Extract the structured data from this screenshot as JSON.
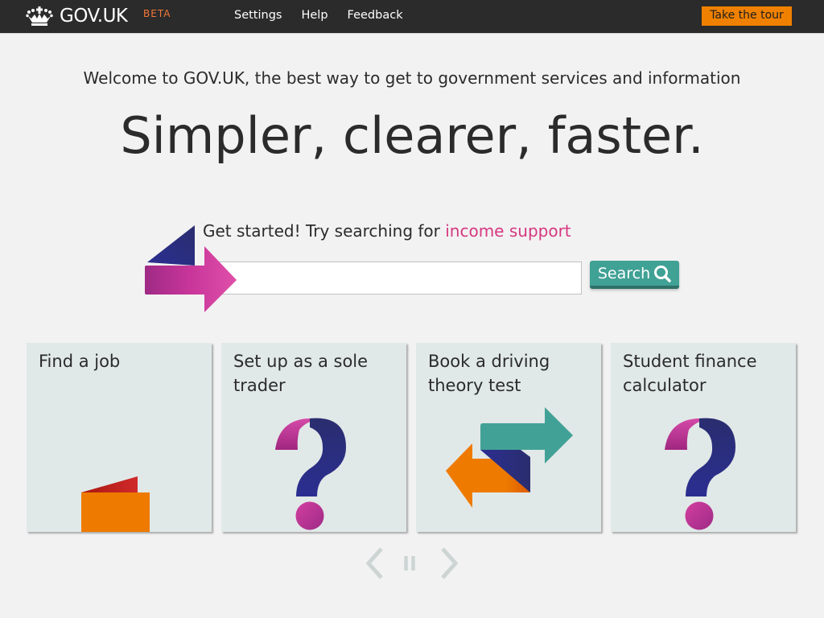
{
  "header": {
    "logo_text": "GOV.UK",
    "beta_label": "BETA",
    "nav": [
      {
        "label": "Settings"
      },
      {
        "label": "Help"
      },
      {
        "label": "Feedback"
      }
    ],
    "tour_button": "Take the tour"
  },
  "hero": {
    "welcome": "Welcome to GOV.UK, the best way to get to government services and information",
    "headline": "Simpler, clearer, faster."
  },
  "search": {
    "prompt_prefix": "Get started! Try searching for ",
    "prompt_link": "income support",
    "input_value": "",
    "button_label": "Search"
  },
  "cards": [
    {
      "title": "Find a job",
      "icon": "folded-leaflet-icon"
    },
    {
      "title": "Set up as a sole trader",
      "icon": "question-mark-icon"
    },
    {
      "title": "Book a driving theory test",
      "icon": "swap-arrows-icon"
    },
    {
      "title": "Student finance calculator",
      "icon": "question-mark-icon"
    }
  ],
  "carousel": {
    "prev": "chevron-left-icon",
    "pause": "pause-icon",
    "next": "chevron-right-icon"
  },
  "colors": {
    "header_bg": "#2b2b2b",
    "beta": "#f47738",
    "tour_button": "#f08100",
    "link_pink": "#d53880",
    "search_button": "#40a195",
    "card_bg": "#e1e8e8",
    "page_bg": "#f2f2f2"
  }
}
